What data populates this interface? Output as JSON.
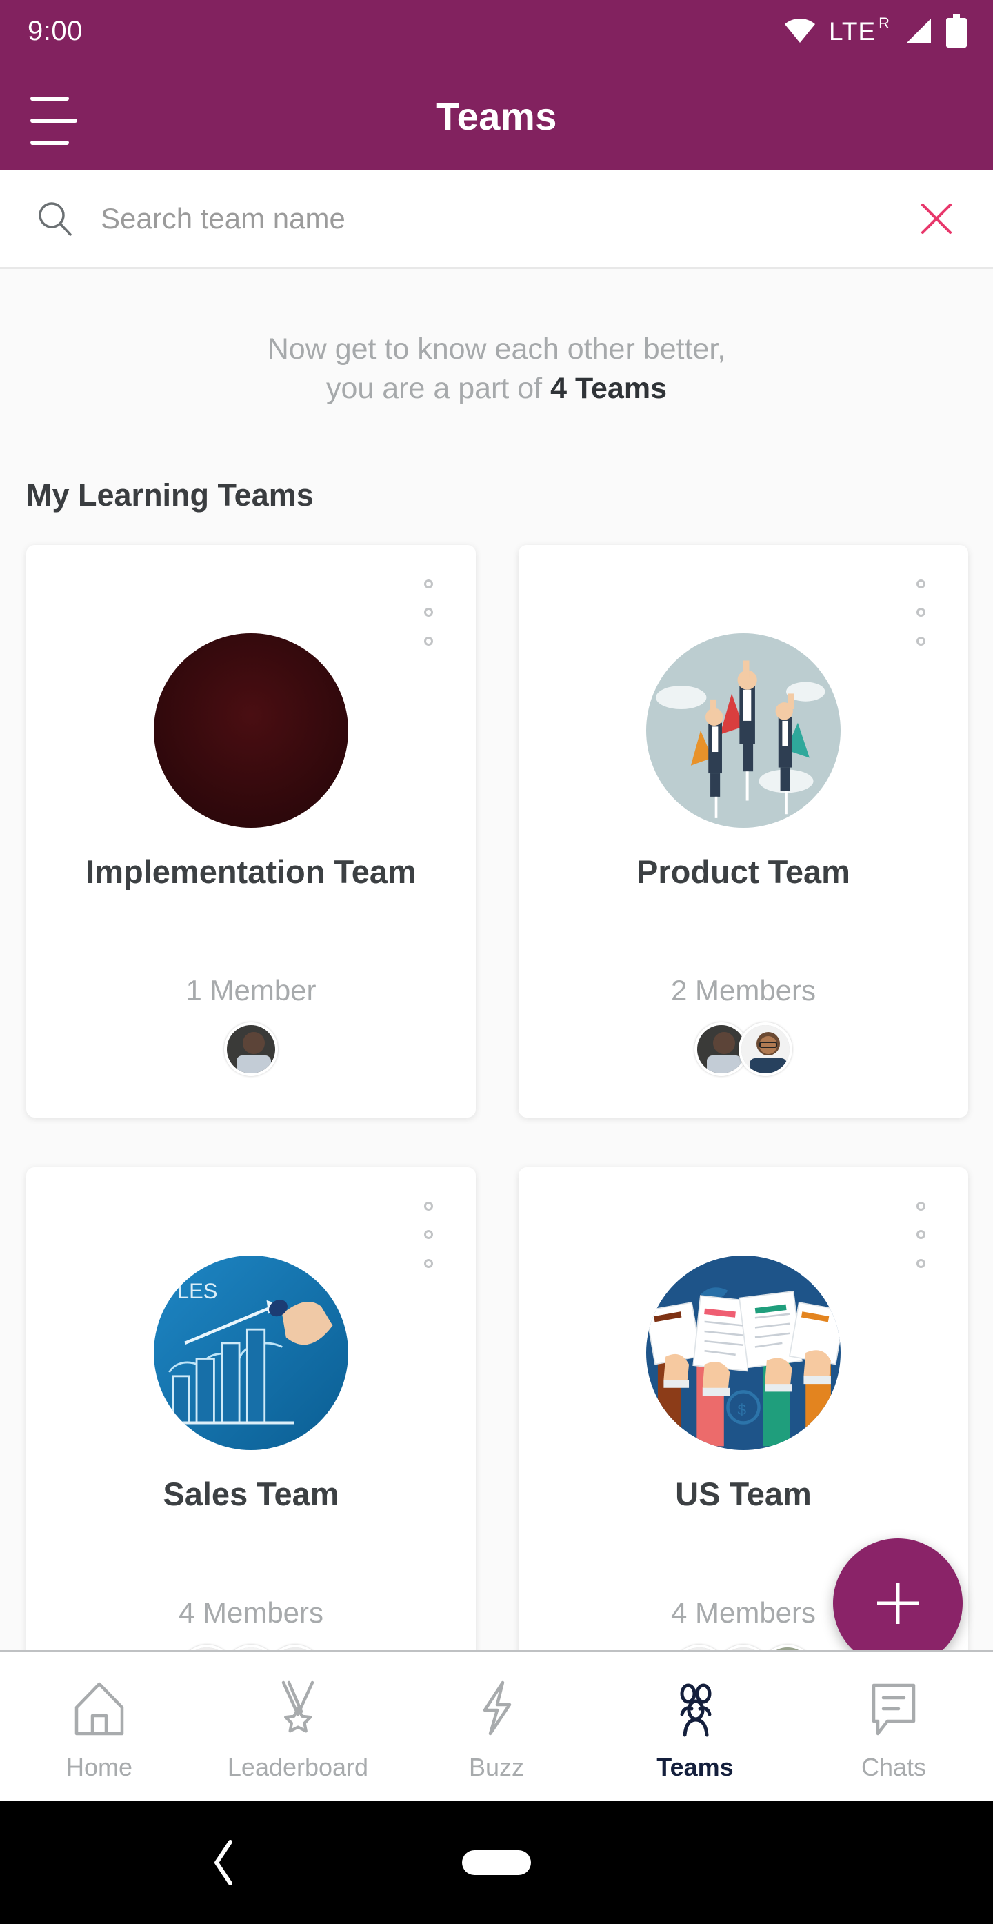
{
  "status_bar": {
    "time": "9:00",
    "network_label": "LTE",
    "roaming_superscript": "R",
    "icons": [
      "wifi-icon",
      "signal-icon",
      "battery-icon"
    ]
  },
  "app_bar": {
    "title": "Teams",
    "menu_icon": "hamburger-menu-icon",
    "background_color": "#82225F"
  },
  "search": {
    "placeholder": "Search team name",
    "value": "",
    "search_icon": "search-icon",
    "clear_icon": "close-icon",
    "clear_color": "#E8376B"
  },
  "main": {
    "tagline_line1": "Now get to know each other better,",
    "tagline_line2_prefix": "you are a part of ",
    "tagline_line2_bold": "4 Teams",
    "section_title": "My Learning Teams",
    "teams": [
      {
        "name": "Implementation Team",
        "members_label": "1 Member",
        "thumb": "solid-maroon-circle",
        "thumb_color": "#3B0A0C",
        "avatar_count": 1,
        "menu_icon": "kebab-menu-icon"
      },
      {
        "name": "Product Team",
        "members_label": "2 Members",
        "thumb": "superhero-businessmen-illustration",
        "thumb_color": "#BCCDD0",
        "avatar_count": 2,
        "menu_icon": "kebab-menu-icon"
      },
      {
        "name": "Sales Team",
        "members_label": "4 Members",
        "thumb": "sales-growth-chart-illustration",
        "thumb_color": "#1078B4",
        "avatar_count": 3,
        "menu_icon": "kebab-menu-icon"
      },
      {
        "name": "US Team",
        "members_label": "4 Members",
        "thumb": "hands-holding-documents-illustration",
        "thumb_color": "#1E5489",
        "avatar_count": 3,
        "menu_icon": "kebab-menu-icon"
      }
    ]
  },
  "fab": {
    "label": "+",
    "icon": "plus-icon",
    "color": "#8A2368"
  },
  "bottom_nav": {
    "active": "Teams",
    "active_color": "#141F3C",
    "inactive_color": "#A8ABAD",
    "items": [
      {
        "label": "Home",
        "icon": "home-icon"
      },
      {
        "label": "Leaderboard",
        "icon": "medal-icon"
      },
      {
        "label": "Buzz",
        "icon": "lightning-bolt-icon"
      },
      {
        "label": "Teams",
        "icon": "people-icon"
      },
      {
        "label": "Chats",
        "icon": "chat-bubble-icon"
      }
    ]
  },
  "android_nav": {
    "back_icon": "back-chevron-icon",
    "home_icon": "home-pill-icon"
  }
}
